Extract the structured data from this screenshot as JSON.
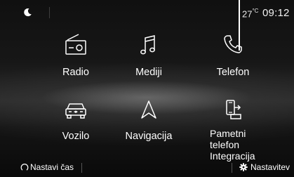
{
  "status_bar": {
    "temperature": "27",
    "temperature_unit": "°C",
    "time": "09:12",
    "night_mode_icon": "moon-icon"
  },
  "tiles": {
    "radio": {
      "label": "Radio",
      "icon": "radio-icon"
    },
    "media": {
      "label": "Mediji",
      "icon": "music-note-icon"
    },
    "phone": {
      "label": "Telefon",
      "icon": "phone-icon"
    },
    "vehicle": {
      "label": "Vozilo",
      "icon": "car-icon"
    },
    "navigation": {
      "label": "Navigacija",
      "icon": "navigation-arrow-icon"
    },
    "smartphone": {
      "label_line1": "Pametni telefon",
      "label_line2": "Integracija",
      "icon": "smartphone-cast-icon"
    }
  },
  "bottom_bar": {
    "resume_label": "Nastavi čas",
    "settings_label": "Nastavitev",
    "resume_icon": "power-arc-icon",
    "settings_icon": "gear-icon"
  },
  "colors": {
    "text": "#ffffff",
    "background": "#141414",
    "divider": "#555555"
  }
}
